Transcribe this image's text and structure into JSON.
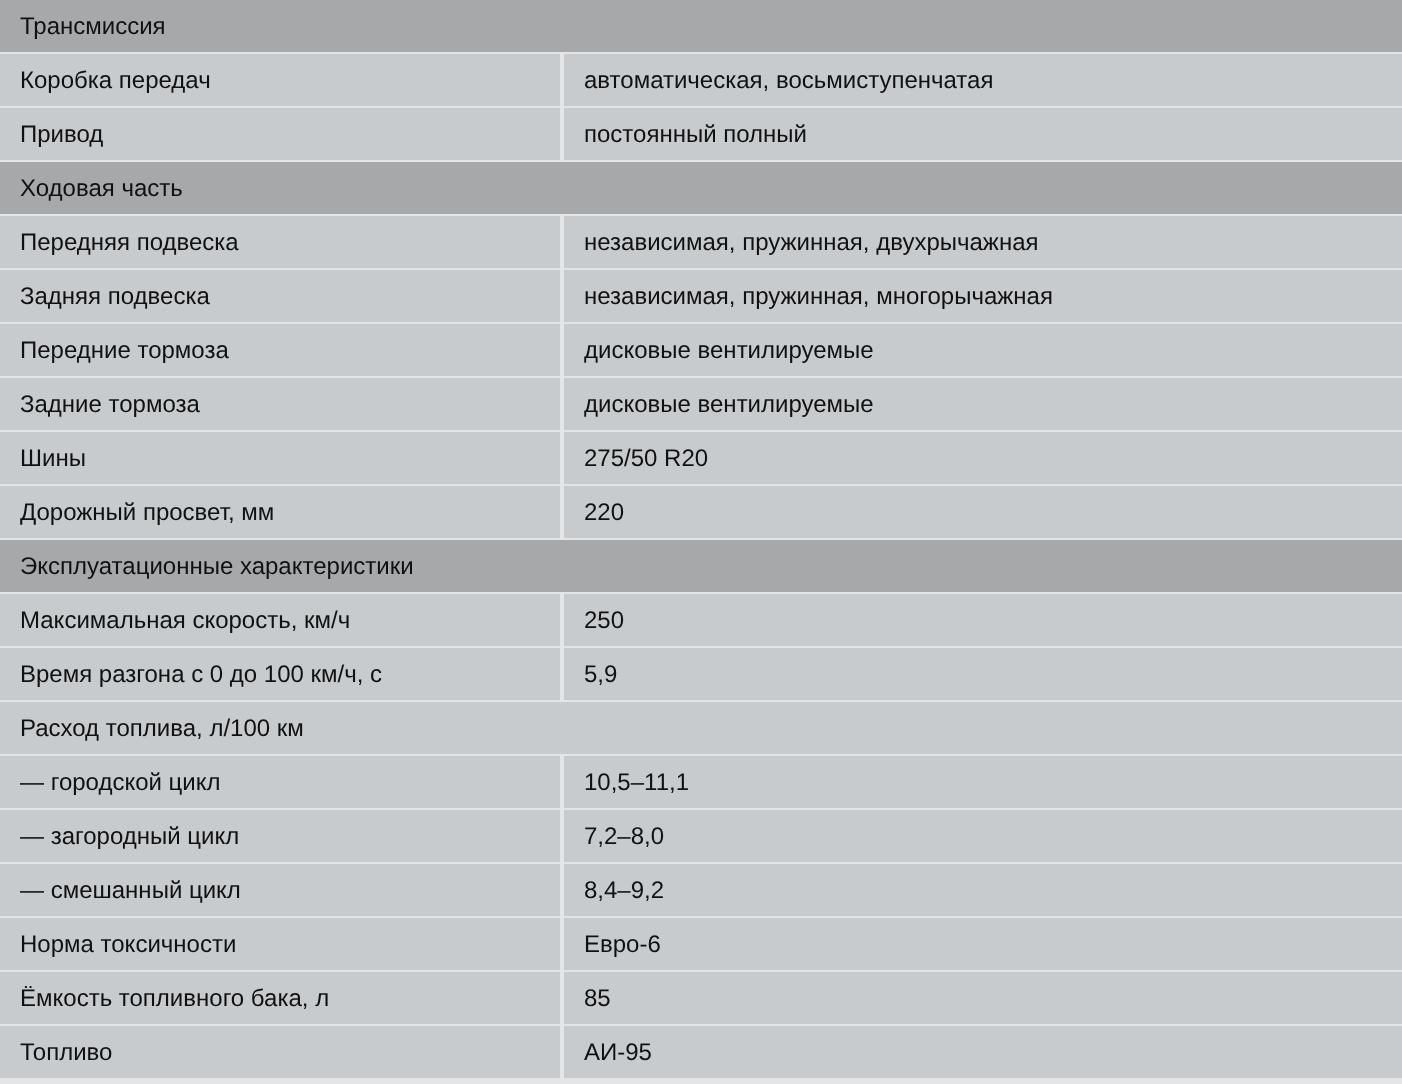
{
  "rows": [
    {
      "kind": "section",
      "label": "Трансмиссия"
    },
    {
      "kind": "row",
      "label": "Коробка передач",
      "value": "автоматическая, восьмиступенчатая"
    },
    {
      "kind": "row",
      "label": "Привод",
      "value": "постоянный полный"
    },
    {
      "kind": "section",
      "label": "Ходовая часть"
    },
    {
      "kind": "row",
      "label": "Передняя подвеска",
      "value": "независимая, пружинная, двухрычажная"
    },
    {
      "kind": "row",
      "label": "Задняя подвеска",
      "value": "независимая, пружинная, многорычажная"
    },
    {
      "kind": "row",
      "label": "Передние тормоза",
      "value": "дисковые вентилируемые"
    },
    {
      "kind": "row",
      "label": "Задние тормоза",
      "value": "дисковые вентилируемые"
    },
    {
      "kind": "row",
      "label": "Шины",
      "value": "275/50 R20"
    },
    {
      "kind": "row",
      "label": "Дорожный просвет, мм",
      "value": "220"
    },
    {
      "kind": "section",
      "label": "Эксплуатационные характеристики"
    },
    {
      "kind": "row",
      "label": "Максимальная скорость, км/ч",
      "value": "250"
    },
    {
      "kind": "row",
      "label": "Время разгона с 0 до 100 км/ч, с",
      "value": "5,9"
    },
    {
      "kind": "subhead",
      "label": "Расход топлива, л/100 км"
    },
    {
      "kind": "row",
      "label": "— городской цикл",
      "value": "10,5–11,1"
    },
    {
      "kind": "row",
      "label": "— загородный цикл",
      "value": "7,2–8,0"
    },
    {
      "kind": "row",
      "label": "— смешанный цикл",
      "value": "8,4–9,2"
    },
    {
      "kind": "row",
      "label": "Норма токсичности",
      "value": "Евро-6"
    },
    {
      "kind": "row",
      "label": "Ёмкость топливного бака, л",
      "value": "85"
    },
    {
      "kind": "row",
      "label": "Топливо",
      "value": "АИ-95"
    }
  ]
}
